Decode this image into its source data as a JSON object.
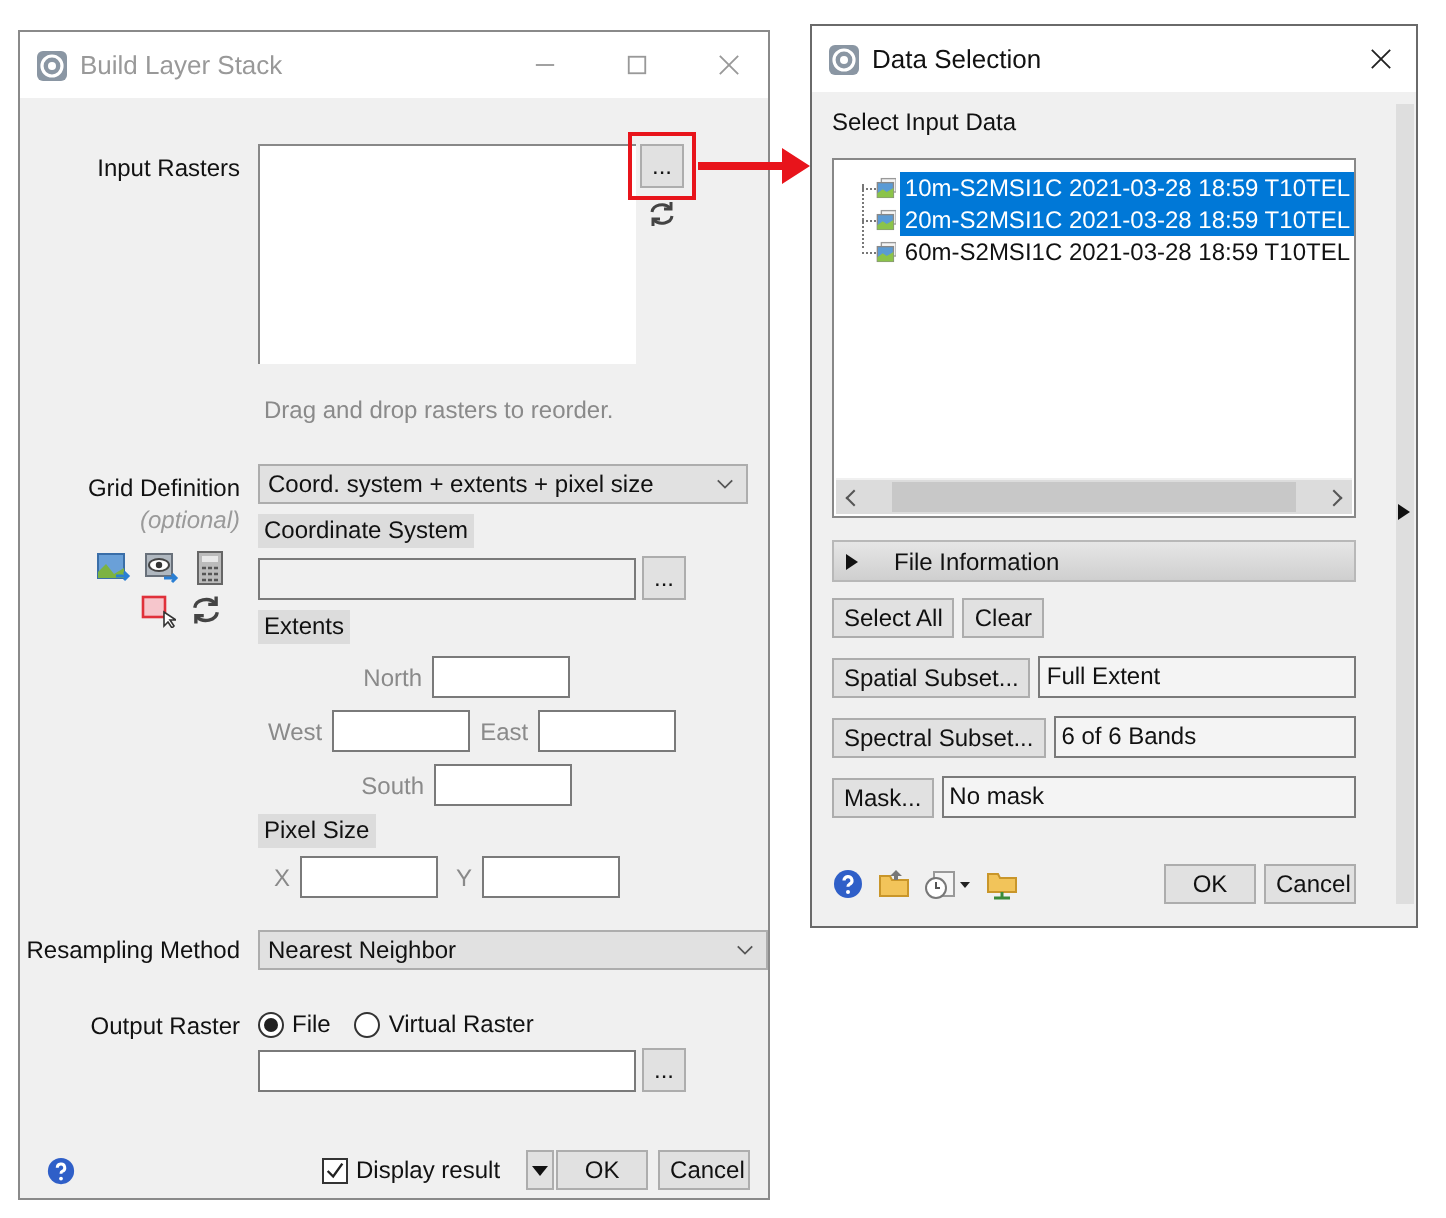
{
  "build_window": {
    "title": "Build Layer Stack",
    "input_rasters_label": "Input Rasters",
    "input_browse": "...",
    "reorder_hint": "Drag and drop rasters to reorder.",
    "grid_definition_label": "Grid Definition",
    "optional_note": "(optional)",
    "grid_mode": "Coord. system + extents + pixel size",
    "coordinate_system_label": "Coordinate System",
    "coordinate_browse": "...",
    "extents_label": "Extents",
    "north_label": "North",
    "west_label": "West",
    "east_label": "East",
    "south_label": "South",
    "pixel_size_label": "Pixel Size",
    "x_label": "X",
    "y_label": "Y",
    "resampling_label": "Resampling Method",
    "resampling_method": "Nearest Neighbor",
    "output_raster_label": "Output Raster",
    "output_options": [
      {
        "label": "File",
        "selected": true
      },
      {
        "label": "Virtual Raster",
        "selected": false
      }
    ],
    "output_browse": "...",
    "display_result": {
      "label": "Display result",
      "checked": true
    },
    "ok": "OK",
    "cancel": "Cancel"
  },
  "data_selection": {
    "title": "Data Selection",
    "select_input_label": "Select Input Data",
    "items": [
      {
        "label": "10m-S2MSI1C 2021-03-28 18:59 T10TEL",
        "selected": true
      },
      {
        "label": "20m-S2MSI1C 2021-03-28 18:59 T10TEL",
        "selected": true
      },
      {
        "label": "60m-S2MSI1C 2021-03-28 18:59 T10TEL",
        "selected": false
      }
    ],
    "file_information": "File Information",
    "select_all": "Select All",
    "clear": "Clear",
    "subsets": [
      {
        "button": "Spatial Subset...",
        "value": "Full Extent"
      },
      {
        "button": "Spectral Subset...",
        "value": "6 of 6 Bands"
      },
      {
        "button": "Mask...",
        "value": "No mask"
      }
    ],
    "ok": "OK",
    "cancel": "Cancel"
  }
}
